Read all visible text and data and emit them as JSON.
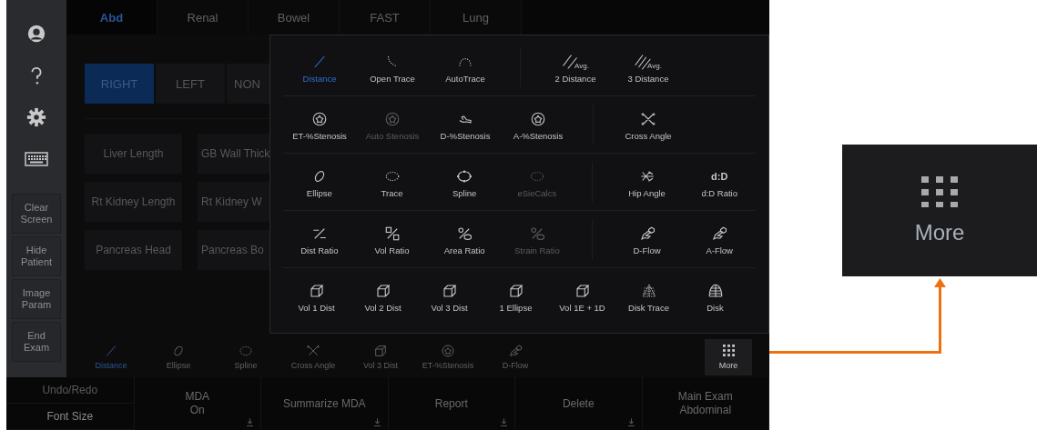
{
  "sidebar": {
    "buttons": [
      {
        "label": "Clear Screen"
      },
      {
        "label": "Hide Patient"
      },
      {
        "label": "Image Param"
      },
      {
        "label": "End Exam"
      }
    ]
  },
  "tabs": [
    {
      "label": "Abd",
      "selected": true
    },
    {
      "label": "Renal",
      "selected": false
    },
    {
      "label": "Bowel",
      "selected": false
    },
    {
      "label": "FAST",
      "selected": false
    },
    {
      "label": "Lung",
      "selected": false
    }
  ],
  "sides": [
    {
      "label": "RIGHT",
      "selected": true
    },
    {
      "label": "LEFT",
      "selected": false
    },
    {
      "label": "NON",
      "selected": false
    }
  ],
  "measurements": [
    "Liver Length",
    "GB Wall Thick",
    "Rt Kidney Length",
    "Rt Kidney W",
    "Pancreas Head",
    "Pancreas Bo"
  ],
  "popup": {
    "rows": [
      {
        "groups": [
          [
            {
              "label": "Distance",
              "kind": "line",
              "selected": true,
              "disabled": false
            },
            {
              "label": "Open Trace",
              "kind": "open-trace",
              "selected": false,
              "disabled": false
            },
            {
              "label": "AutoTrace",
              "kind": "auto-trace",
              "selected": false,
              "disabled": false
            }
          ],
          [
            {
              "label": "2 Distance",
              "kind": "avg2",
              "caption": "Avg.",
              "selected": false,
              "disabled": false
            },
            {
              "label": "3 Distance",
              "kind": "avg3",
              "caption": "Avg.",
              "selected": false,
              "disabled": false
            }
          ]
        ]
      },
      {
        "groups": [
          [
            {
              "label": "ET-%Stenosis",
              "kind": "ring",
              "selected": false,
              "disabled": false
            },
            {
              "label": "Auto Stenosis",
              "kind": "ring",
              "selected": false,
              "disabled": true
            },
            {
              "label": "D-%Stenosis",
              "kind": "vessel",
              "selected": false,
              "disabled": false
            },
            {
              "label": "A-%Stenosis",
              "kind": "ring",
              "selected": false,
              "disabled": false
            }
          ],
          [
            {
              "label": "Cross Angle",
              "kind": "cross",
              "selected": false,
              "disabled": false
            }
          ]
        ]
      },
      {
        "groups": [
          [
            {
              "label": "Ellipse",
              "kind": "ellipse",
              "selected": false,
              "disabled": false
            },
            {
              "label": "Trace",
              "kind": "dotted-ellipse",
              "selected": false,
              "disabled": false
            },
            {
              "label": "Spline",
              "kind": "spline",
              "selected": false,
              "disabled": false
            },
            {
              "label": "eSieCalcs",
              "kind": "dotted-ellipse",
              "selected": false,
              "disabled": true
            }
          ],
          [
            {
              "label": "Hip Angle",
              "kind": "hip",
              "selected": false,
              "disabled": false
            },
            {
              "label": "d:D Ratio",
              "kind": "glyph",
              "glyph": "d:D",
              "selected": false,
              "disabled": false
            }
          ]
        ]
      },
      {
        "groups": [
          [
            {
              "label": "Dist Ratio",
              "kind": "dist-ratio",
              "selected": false,
              "disabled": false
            },
            {
              "label": "Vol Ratio",
              "kind": "vol-ratio",
              "selected": false,
              "disabled": false
            },
            {
              "label": "Area Ratio",
              "kind": "percent",
              "selected": false,
              "disabled": false
            },
            {
              "label": "Strain Ratio",
              "kind": "percent",
              "selected": false,
              "disabled": true
            }
          ],
          [
            {
              "label": "D-Flow",
              "kind": "flow",
              "selected": false,
              "disabled": false
            },
            {
              "label": "A-Flow",
              "kind": "flow",
              "selected": false,
              "disabled": false
            }
          ]
        ]
      },
      {
        "groups": [
          [
            {
              "label": "Vol 1 Dist",
              "kind": "cube",
              "selected": false,
              "disabled": false
            },
            {
              "label": "Vol 2 Dist",
              "kind": "cube",
              "selected": false,
              "disabled": false
            },
            {
              "label": "Vol 3 Dist",
              "kind": "cube",
              "selected": false,
              "disabled": false
            },
            {
              "label": "1 Ellipse",
              "kind": "cube",
              "selected": false,
              "disabled": false
            },
            {
              "label": "Vol 1E + 1D",
              "kind": "cube",
              "selected": false,
              "disabled": false
            },
            {
              "label": "Disk Trace",
              "kind": "disk-trace",
              "selected": false,
              "disabled": false
            },
            {
              "label": "Disk",
              "kind": "disk",
              "selected": false,
              "disabled": false
            }
          ]
        ]
      }
    ]
  },
  "tools": [
    {
      "label": "Distance",
      "kind": "line",
      "selected": true
    },
    {
      "label": "Ellipse",
      "kind": "ellipse",
      "selected": false
    },
    {
      "label": "Spline",
      "kind": "spline",
      "selected": false
    },
    {
      "label": "Cross Angle",
      "kind": "cross",
      "selected": false
    },
    {
      "label": "Vol 3 Dist",
      "kind": "cube",
      "selected": false
    },
    {
      "label": "ET-%Stenosis",
      "kind": "ring",
      "selected": false
    },
    {
      "label": "D-Flow",
      "kind": "flow",
      "selected": false
    }
  ],
  "more_button": {
    "label": "More"
  },
  "bottom_bar": {
    "stack": [
      {
        "label": "Undo/Redo",
        "disabled": true
      },
      {
        "label": "Font Size",
        "disabled": false
      }
    ],
    "cells": [
      {
        "label": "MDA",
        "value": "On",
        "has_menu": true
      },
      {
        "label": "Summarize MDA",
        "has_menu": true
      },
      {
        "label": "Report",
        "has_menu": true
      },
      {
        "label": "Delete",
        "has_menu": true
      },
      {
        "label": "Main Exam",
        "value": "Abdominal",
        "has_menu": false
      }
    ]
  },
  "callout": {
    "label": "More"
  }
}
